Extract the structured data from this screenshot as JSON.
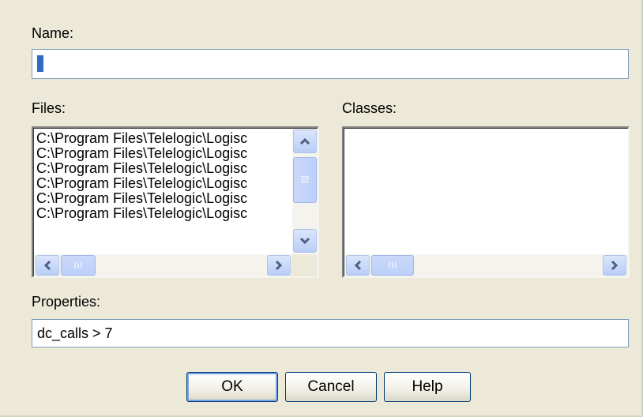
{
  "dialog": {
    "name_label": "Name:",
    "name_value": "",
    "files_label": "Files:",
    "classes_label": "Classes:",
    "properties_label": "Properties:",
    "properties_value": "dc_calls > 7"
  },
  "files": {
    "items": [
      "C:\\Program Files\\Telelogic\\Logisc",
      "C:\\Program Files\\Telelogic\\Logisc",
      "C:\\Program Files\\Telelogic\\Logisc",
      "C:\\Program Files\\Telelogic\\Logisc",
      "C:\\Program Files\\Telelogic\\Logisc",
      "C:\\Program Files\\Telelogic\\Logisc"
    ]
  },
  "classes": {
    "items": []
  },
  "buttons": {
    "ok": "OK",
    "cancel": "Cancel",
    "help": "Help"
  },
  "icons": {
    "scroll_up": "chevron-up-icon",
    "scroll_down": "chevron-down-icon",
    "scroll_left": "chevron-left-icon",
    "scroll_right": "chevron-right-icon"
  },
  "colors": {
    "dialog_bg": "#ece9d8",
    "scroll_arrow": "#4d6185",
    "button_border": "#003c74",
    "selection": "#316ac5"
  }
}
